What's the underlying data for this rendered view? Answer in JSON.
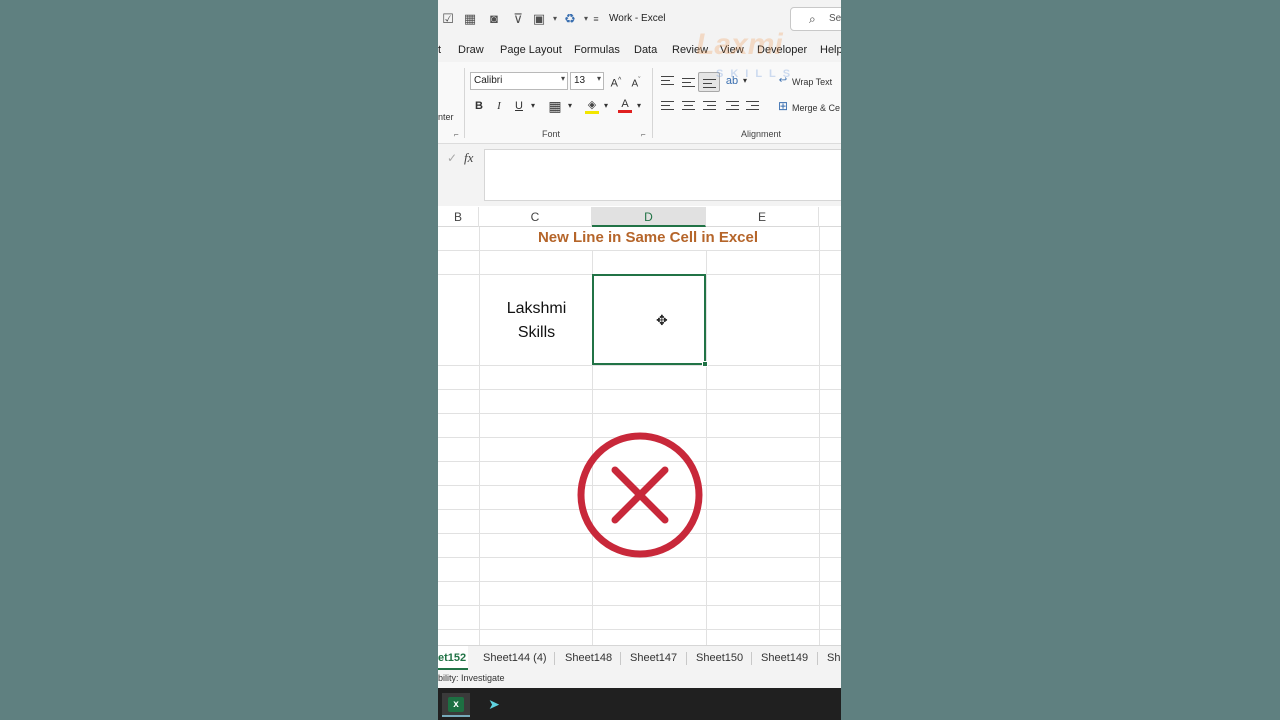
{
  "window": {
    "title": "Work - Excel"
  },
  "search": {
    "label": "Se"
  },
  "menu": {
    "tabs": [
      "t",
      "Draw",
      "Page Layout",
      "Formulas",
      "Data",
      "Review",
      "View",
      "Developer",
      "Help"
    ]
  },
  "ribbon": {
    "font_name": "Calibri",
    "font_size": "13",
    "wrap_text": "Wrap Text",
    "merge_center": "Merge & Ce",
    "left_fragment": "nter",
    "groups": {
      "font": "Font",
      "alignment": "Alignment"
    }
  },
  "formula_bar": {
    "fx": "fx",
    "value": ""
  },
  "columns": [
    "B",
    "C",
    "D",
    "E"
  ],
  "active_column": "D",
  "sheet": {
    "title": "New Line in Same Cell in Excel",
    "cell_c3_line1": "Lakshmi",
    "cell_c3_line2": "Skills"
  },
  "sheet_tabs": [
    "et152",
    "Sheet144 (4)",
    "Sheet148",
    "Sheet147",
    "Sheet150",
    "Sheet149",
    "She"
  ],
  "active_sheet": "et152",
  "status": {
    "text": "bility: Investigate"
  },
  "watermark": {
    "main": "Laxmi",
    "sub": "SKILLS"
  },
  "colors": {
    "accent": "#217346",
    "title": "#b5652a",
    "error": "#c8283a"
  },
  "icons": [
    "save-icon",
    "table-icon",
    "camera-icon",
    "filter-icon",
    "image-icon",
    "paint-format-icon",
    "search-icon",
    "fx-icon",
    "cell-cursor-icon",
    "error-x-icon",
    "excel-taskbar-icon"
  ]
}
